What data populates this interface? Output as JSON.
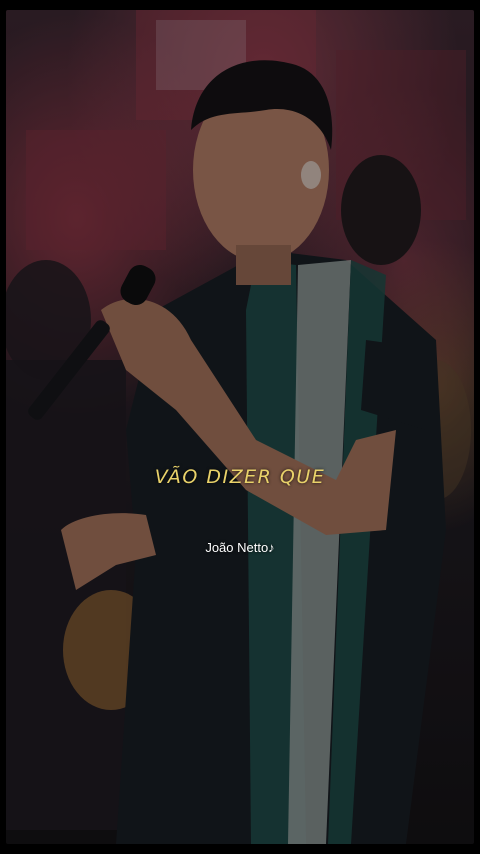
{
  "video": {
    "lyric_text": "VÃO DIZER QUE",
    "artist_credit": "João Netto♪"
  },
  "colors": {
    "lyric": "#e9d26a",
    "credit": "#ffffff",
    "stage_light": "#d05060",
    "shirt_dark": "#171c22",
    "shirt_stripe_teal": "#1f4b48",
    "shirt_stripe_gray": "#8f9a98"
  },
  "icons": {
    "background": "concert-photo",
    "singer": "singer-figure",
    "microphone": "microphone-icon"
  }
}
